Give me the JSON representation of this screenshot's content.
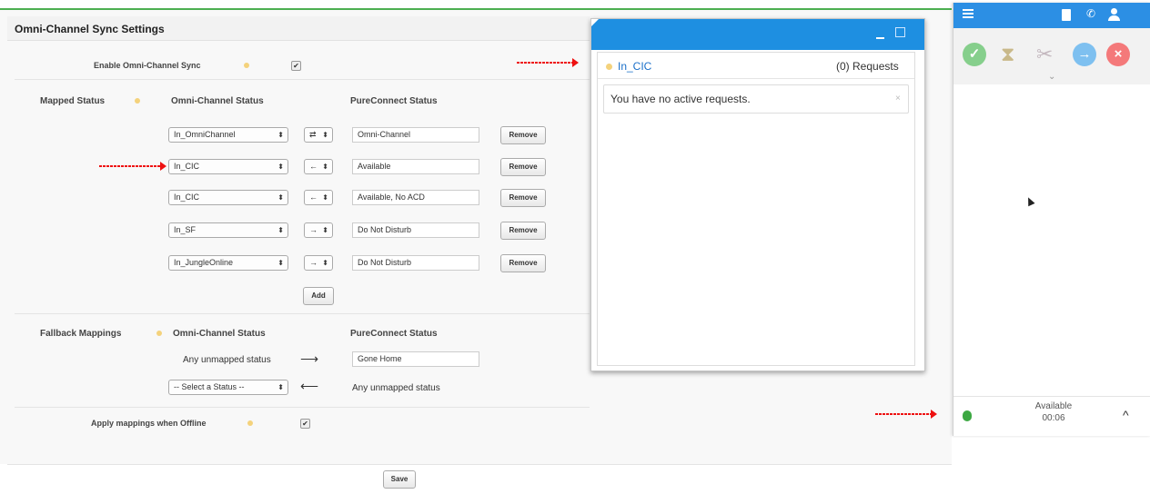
{
  "settings": {
    "title": "Omni-Channel Sync Settings",
    "enable_label": "Enable Omni-Channel Sync",
    "enable_checked": true,
    "mapped": {
      "section_label": "Mapped Status",
      "col_omni": "Omni-Channel Status",
      "col_pure": "PureConnect Status",
      "rows": [
        {
          "omni": "In_OmniChannel",
          "direction": "⇄",
          "pure": "Omni-Channel",
          "remove": "Remove"
        },
        {
          "omni": "In_CIC",
          "direction": "←",
          "pure": "Available",
          "remove": "Remove"
        },
        {
          "omni": "In_CIC",
          "direction": "←",
          "pure": "Available, No ACD",
          "remove": "Remove"
        },
        {
          "omni": "In_SF",
          "direction": "→",
          "pure": "Do Not Disturb",
          "remove": "Remove"
        },
        {
          "omni": "In_JungleOnline",
          "direction": "→",
          "pure": "Do Not Disturb",
          "remove": "Remove"
        }
      ],
      "add_label": "Add"
    },
    "fallback": {
      "section_label": "Fallback Mappings",
      "col_omni": "Omni-Channel Status",
      "col_pure": "PureConnect Status",
      "row1_left": "Any unmapped status",
      "row1_arrow": "⟶",
      "row1_value": "Gone Home",
      "row2_select": "-- Select a Status --",
      "row2_arrow": "⟵",
      "row2_right": "Any unmapped status"
    },
    "offline_label": "Apply mappings when Offline",
    "offline_checked": true,
    "save_label": "Save"
  },
  "omni_popup": {
    "status_name": "In_CIC",
    "requests_label": "(0) Requests",
    "empty_message": "You have no active requests."
  },
  "softphone": {
    "status_label": "Available",
    "timer": "00:06"
  },
  "colors": {
    "accent_blue": "#2c8fe4",
    "status_green": "#4caf50",
    "status_red": "#f0524d",
    "annotation_red": "#e11111"
  }
}
